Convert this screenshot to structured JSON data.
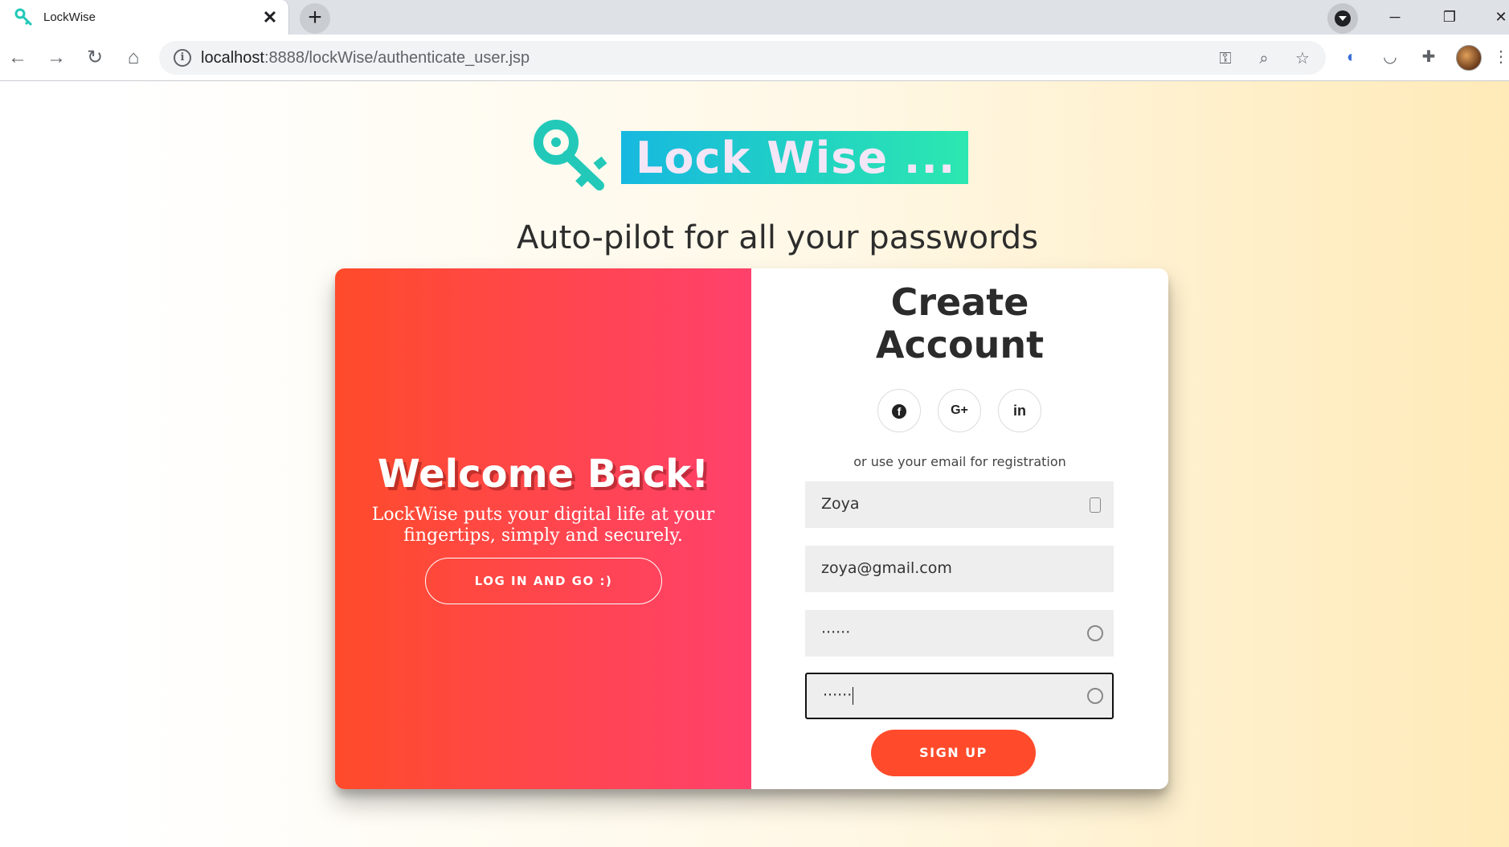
{
  "browser": {
    "tab_title": "LockWise",
    "url_host": "localhost",
    "url_rest": ":8888/lockWise/authenticate_user.jsp"
  },
  "page": {
    "brand": "Lock Wise ...",
    "tagline": "Auto-pilot for all your passwords"
  },
  "overlay": {
    "heading": "Welcome Back!",
    "text": "LockWise puts your digital life at your fingertips, simply and securely.",
    "button": "LOG IN AND GO :)"
  },
  "signup_form": {
    "title": "Create Account",
    "social": {
      "facebook": "f",
      "google": "G+",
      "linkedin": "in"
    },
    "hint": "or use your email for registration",
    "name_value": "Zoya",
    "email_value": "zoya@gmail.com",
    "password_value": "······",
    "confirm_value": "······",
    "button": "SIGN UP"
  },
  "colors": {
    "overlay_start": "#ff4b2b",
    "overlay_end": "#ff416c",
    "brand_teal": "#20d0c4"
  }
}
